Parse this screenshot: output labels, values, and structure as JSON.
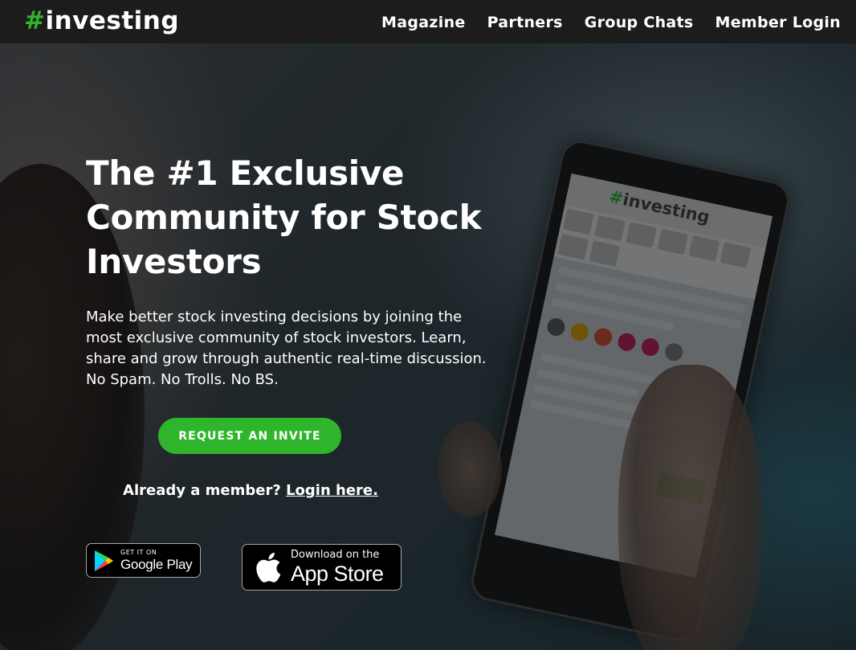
{
  "header": {
    "logo_hash": "#",
    "logo_text": "investing",
    "nav": [
      {
        "label": "Magazine"
      },
      {
        "label": "Partners"
      },
      {
        "label": "Group Chats"
      },
      {
        "label": "Member Login"
      }
    ]
  },
  "hero": {
    "headline": "The #1 Exclusive Community for Stock Investors",
    "description": "Make better stock investing decisions by joining the most exclusive community of stock investors. Learn, share and grow through authentic real-time discussion. No Spam. No Trolls. No BS.",
    "cta_label": "REQUEST AN INVITE",
    "member_prompt": "Already a member?",
    "login_link": "Login here."
  },
  "badges": {
    "google_play_small": "GET IT ON",
    "google_play_big": "Google Play",
    "app_store_small": "Download on the",
    "app_store_big": "App Store"
  },
  "colors": {
    "accent_green": "#2fb52c",
    "nav_background": "#1c1c1c",
    "text": "#ffffff"
  },
  "icons": [
    "google-play-icon",
    "apple-icon"
  ]
}
